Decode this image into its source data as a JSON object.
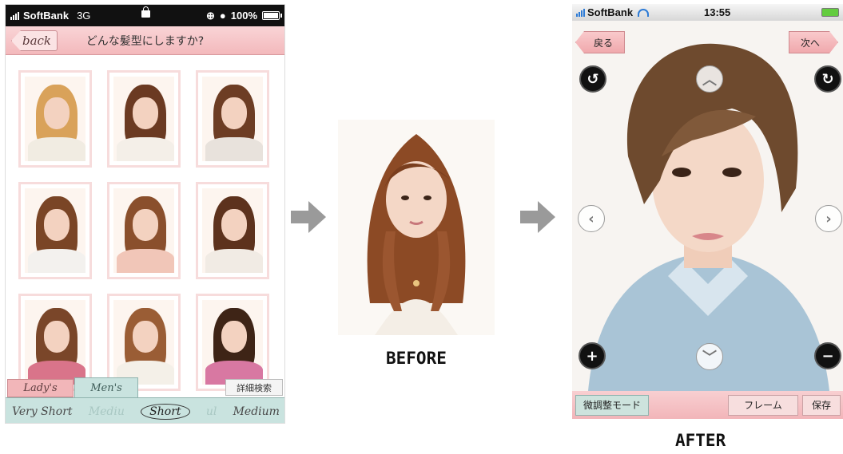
{
  "left_phone": {
    "status": {
      "carrier": "SoftBank",
      "network": "3G",
      "battery": "100%"
    },
    "nav": {
      "back_label": "back",
      "title": "どんな髪型にしますか?"
    },
    "thumbnails": [
      {
        "hair": "#d9a25a",
        "top": "#f1ece2"
      },
      {
        "hair": "#6b3a22",
        "top": "#f4efe8"
      },
      {
        "hair": "#6d3d24",
        "top": "#e8e2dc"
      },
      {
        "hair": "#7a4526",
        "top": "#f3f1ee"
      },
      {
        "hair": "#8a4f2c",
        "top": "#f1c6b8"
      },
      {
        "hair": "#5d321d",
        "top": "#f1ebe4"
      },
      {
        "hair": "#7a4629",
        "top": "#d9748a"
      },
      {
        "hair": "#9a5d35",
        "top": "#f4f0e8"
      },
      {
        "hair": "#3e2416",
        "top": "#d878a2"
      }
    ],
    "tabs": {
      "lady": "Lady's",
      "men": "Men's",
      "search": "詳細検索"
    },
    "lengths": {
      "very_short": "Very Short",
      "short": "Short",
      "medium": "Medium",
      "ghost_left": "Mediu",
      "ghost_right": "ul"
    }
  },
  "before_label": "BEFORE",
  "after_label": "AFTER",
  "right_phone": {
    "status": {
      "carrier": "SoftBank",
      "time": "13:55"
    },
    "back_label": "戻る",
    "next_label": "次へ",
    "controls": {
      "rotate_left_icon": "↺",
      "rotate_right_icon": "↻",
      "up_icon": "︿",
      "down_icon": "﹀",
      "left_icon": "‹",
      "right_icon": "›",
      "zoom_in_icon": "+",
      "zoom_out_icon": "−"
    },
    "bottom": {
      "fine_tune": "微調整モード",
      "frame": "フレーム",
      "save": "保存"
    }
  },
  "colors": {
    "pink": "#f3b9bc",
    "mint": "#c9e3df",
    "arrow": "#9a9a9a"
  }
}
